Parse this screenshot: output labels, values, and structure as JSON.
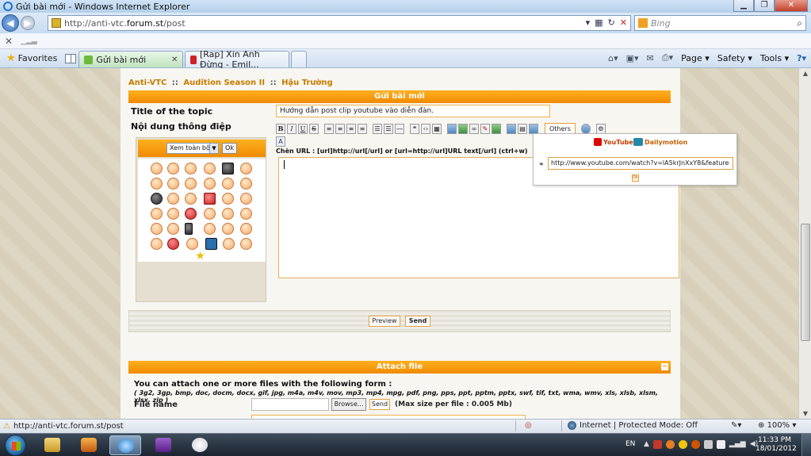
{
  "window": {
    "title": "Gửi bài mới - Windows Internet Explorer"
  },
  "address": {
    "url_prefix": "http://anti-vtc.",
    "url_domain": "forum.st",
    "url_path": "/post",
    "search_placeholder": "Bing"
  },
  "tabs": {
    "favorites": "Favorites",
    "items": [
      {
        "label": "Gửi bài mới",
        "color": "#6fb83b"
      },
      {
        "label": "[Rap] Xin Anh Đừng - Emil...",
        "color": "#cc2222"
      }
    ]
  },
  "commandbar": {
    "page": "Page ▾",
    "safety": "Safety ▾",
    "tools": "Tools ▾",
    "help": "?▾"
  },
  "forum": {
    "breadcrumb": [
      "Anti-VTC",
      "Audition Season II",
      "Hậu Trường"
    ],
    "breadcrumb_sep": "::",
    "post_header": "Gửi bài mới",
    "title_label": "Title of the topic",
    "title_value": "Hướng dẫn post clip youtube vào diễn đàn.",
    "message_label": "Nội dung thông điệp",
    "smilies_select": "Xem toàn bộ",
    "smilies_ok": "Ok",
    "toolbar_others": "Others",
    "insert_url_hint": "Chèn URL : [url]http://url[/url] or [url=http://url]URL text[/url] (ctrl+w)",
    "preview": "Preview",
    "send": "Send"
  },
  "video_popup": {
    "youtube": "YouTube",
    "dailymotion": "Dailymotion",
    "url_value": "http://www.youtube.com/watch?v=lA5krJnXxY8&feature",
    "ok": "Ok"
  },
  "attach": {
    "header": "Attach file",
    "minimize": "−",
    "intro": "You can attach one or more files with the following form :",
    "extensions": "( 3g2, 3gp, bmp, doc, docm, docx, gif, jpg, m4a, m4v, mov, mp3, mp4, mpg, pdf, png, pps, ppt, pptm, pptx, swf, tif, txt, wma, wmv, xls, xlsb, xlsm, xlsx, zip )",
    "file_name_label": "File name",
    "browse": "Browse...",
    "send": "Send",
    "max_size": "(Max size per file : 0.005 Mb)"
  },
  "status": {
    "url": "http://anti-vtc.forum.st/post",
    "zone": "Internet | Protected Mode: Off",
    "zoom": "100%"
  },
  "taskbar": {
    "lang": "EN",
    "time": "11:33 PM",
    "date": "18/01/2012"
  }
}
